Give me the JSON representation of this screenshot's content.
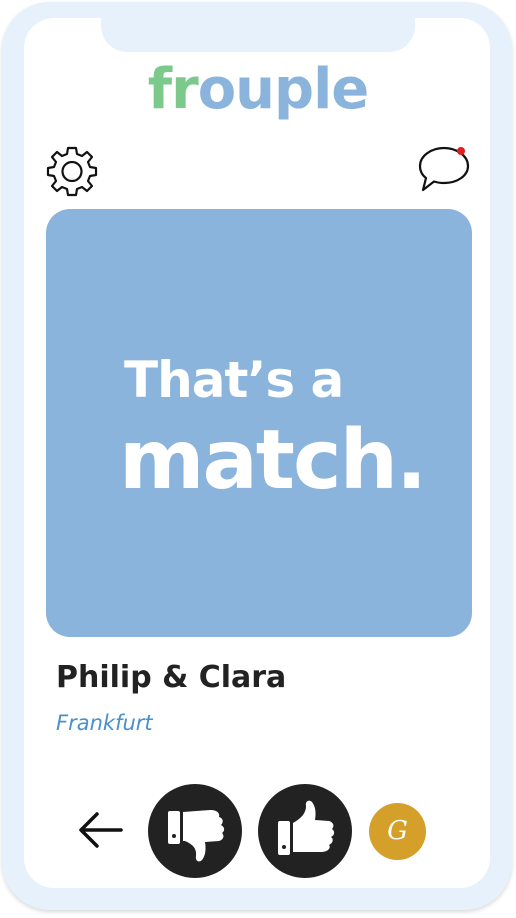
{
  "app": {
    "logo_part1": "fr",
    "logo_part2": "ouple"
  },
  "header": {
    "settings_icon": "gear-icon",
    "chat_icon": "chat-bubble-icon",
    "chat_has_notification": true
  },
  "match_card": {
    "line1": "That’s a",
    "line2": "match."
  },
  "profile": {
    "names": "Philip & Clara",
    "city": "Frankfurt"
  },
  "actions": {
    "back_icon": "arrow-left-icon",
    "dislike_icon": "thumbs-down-icon",
    "like_icon": "thumbs-up-icon",
    "avatar_initial": "G"
  },
  "colors": {
    "logo_green": "#7cc98c",
    "logo_blue": "#8ab4dc",
    "card_blue": "#8ab4dc",
    "city_blue": "#4a90c9",
    "notification_red": "#e02020",
    "avatar_gold": "#d4a02a",
    "button_dark": "#222222"
  }
}
